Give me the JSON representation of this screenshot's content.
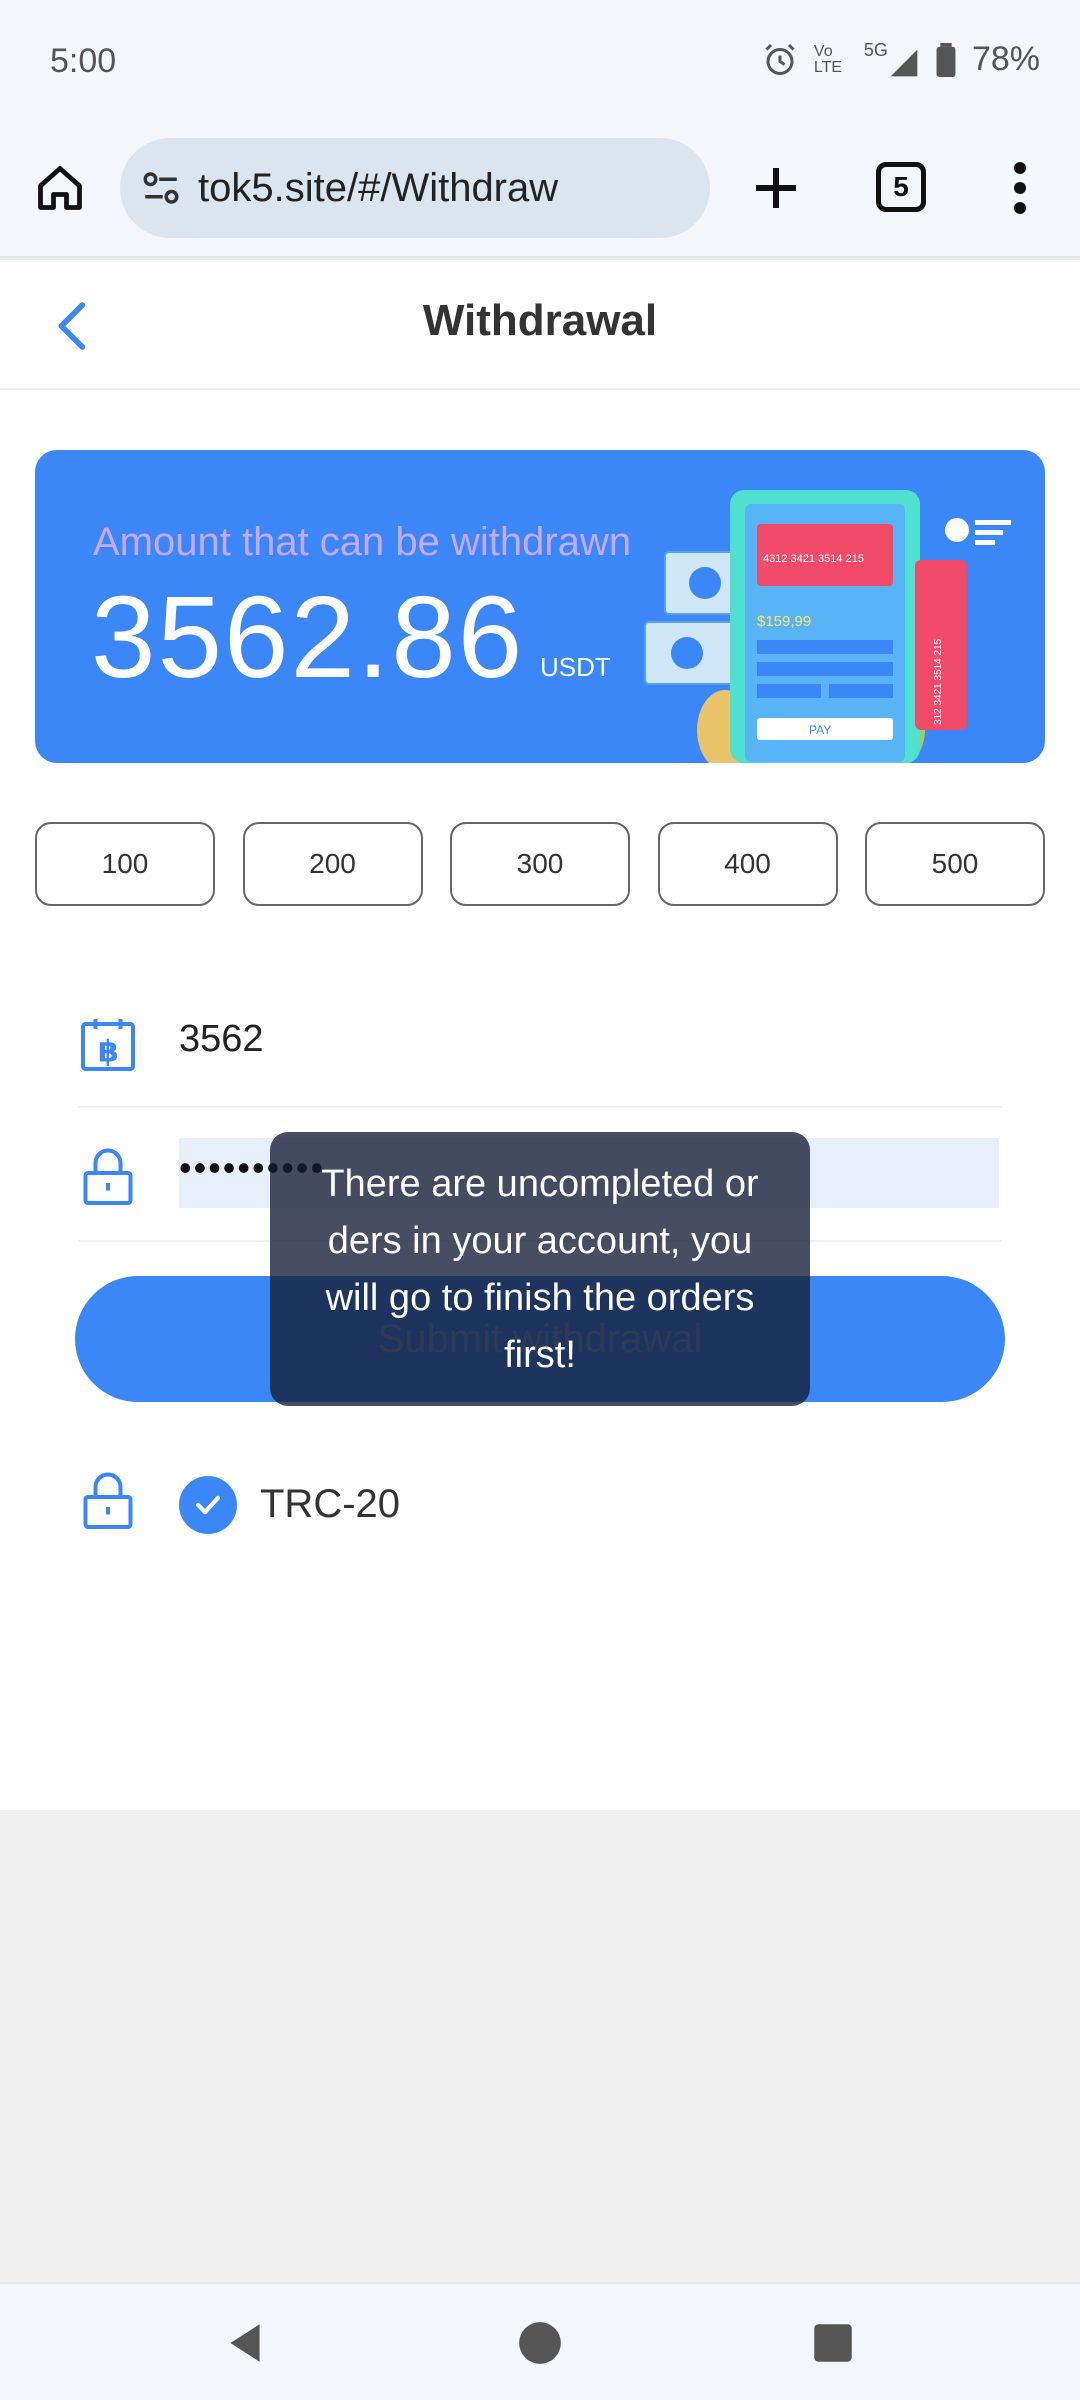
{
  "status_bar": {
    "time": "5:00",
    "network": "5G",
    "volte": "Vo LTE",
    "battery": "78%"
  },
  "browser": {
    "url": "tok5.site/#/Withdraw",
    "tab_count": "5"
  },
  "header": {
    "title": "Withdrawal"
  },
  "balance": {
    "label": "Amount that can be withdrawn",
    "value": "3562.86",
    "unit": "USDT",
    "illustration": {
      "card_number_1": "4312 3421 3514 215",
      "card_number_2": "312 3421 3514 215",
      "price": "$159,99",
      "pay_label": "PAY"
    }
  },
  "quick_amounts": [
    "100",
    "200",
    "300",
    "400",
    "500"
  ],
  "form": {
    "amount_value": "3562",
    "password_mask": "••••••••••",
    "submit_label": "Submit withdrawal"
  },
  "network_option": {
    "label": "TRC-20",
    "checked": true
  },
  "toast": {
    "message": "There are uncompleted or ders in your account, you will go to finish the orders first!"
  },
  "colors": {
    "primary": "#3b87f7",
    "toast_bg": "#1a2440"
  }
}
